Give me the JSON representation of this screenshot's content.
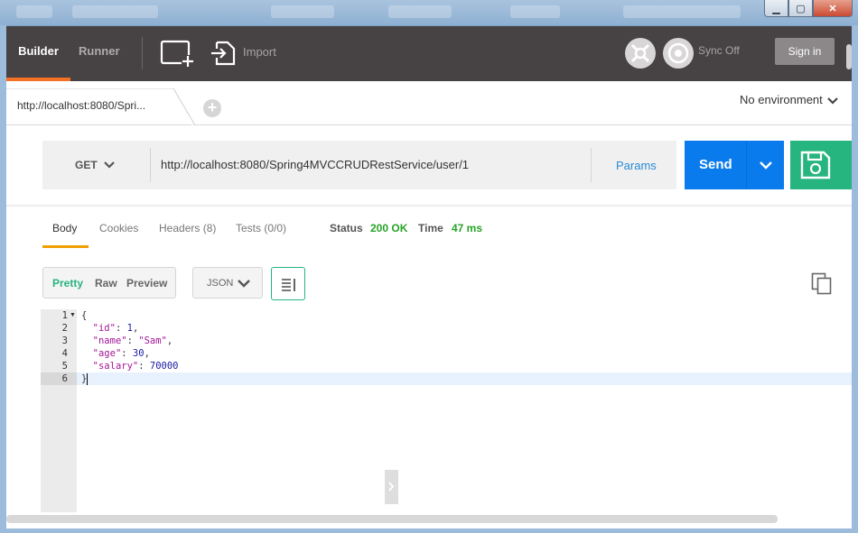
{
  "window": {
    "minimize": "▁",
    "maximize": "▢",
    "close": "✕"
  },
  "header": {
    "tabs": [
      {
        "label": "Builder",
        "active": true
      },
      {
        "label": "Runner",
        "active": false
      }
    ],
    "import_label": "Import",
    "sync_label": "Sync Off",
    "signin_label": "Sign in",
    "accent_color": "#f47023"
  },
  "request_tabs": {
    "active_tab_label": "http://localhost:8080/Spri...",
    "add_icon": "+",
    "environment": "No environment"
  },
  "request": {
    "method": "GET",
    "url": "http://localhost:8080/Spring4MVCCRUDRestService/user/1",
    "params_label": "Params",
    "send_label": "Send",
    "send_color": "#097bed",
    "save_color": "#26b47f"
  },
  "response": {
    "tabs": [
      "Body",
      "Cookies",
      "Headers (8)",
      "Tests (0/0)"
    ],
    "status_label": "Status",
    "status_value": "200 OK",
    "time_label": "Time",
    "time_value": "47 ms",
    "status_color": "#27a327"
  },
  "format": {
    "modes": [
      "Pretty",
      "Raw",
      "Preview"
    ],
    "selected_mode": "Pretty",
    "language": "JSON"
  },
  "editor": {
    "line_numbers": [
      "1",
      "2",
      "3",
      "4",
      "5",
      "6"
    ],
    "lines": [
      {
        "parts": [
          [
            "p",
            "{"
          ]
        ]
      },
      {
        "parts": [
          [
            "p",
            "  "
          ],
          [
            "k",
            "\"id\""
          ],
          [
            "p",
            ": "
          ],
          [
            "n",
            "1"
          ],
          [
            "p",
            ","
          ]
        ]
      },
      {
        "parts": [
          [
            "p",
            "  "
          ],
          [
            "k",
            "\"name\""
          ],
          [
            "p",
            ": "
          ],
          [
            "s",
            "\"Sam\""
          ],
          [
            "p",
            ","
          ]
        ]
      },
      {
        "parts": [
          [
            "p",
            "  "
          ],
          [
            "k",
            "\"age\""
          ],
          [
            "p",
            ": "
          ],
          [
            "n",
            "30"
          ],
          [
            "p",
            ","
          ]
        ]
      },
      {
        "parts": [
          [
            "p",
            "  "
          ],
          [
            "k",
            "\"salary\""
          ],
          [
            "p",
            ": "
          ],
          [
            "n",
            "70000"
          ]
        ]
      },
      {
        "parts": [
          [
            "p",
            "}"
          ]
        ]
      }
    ],
    "active_line": 6
  }
}
